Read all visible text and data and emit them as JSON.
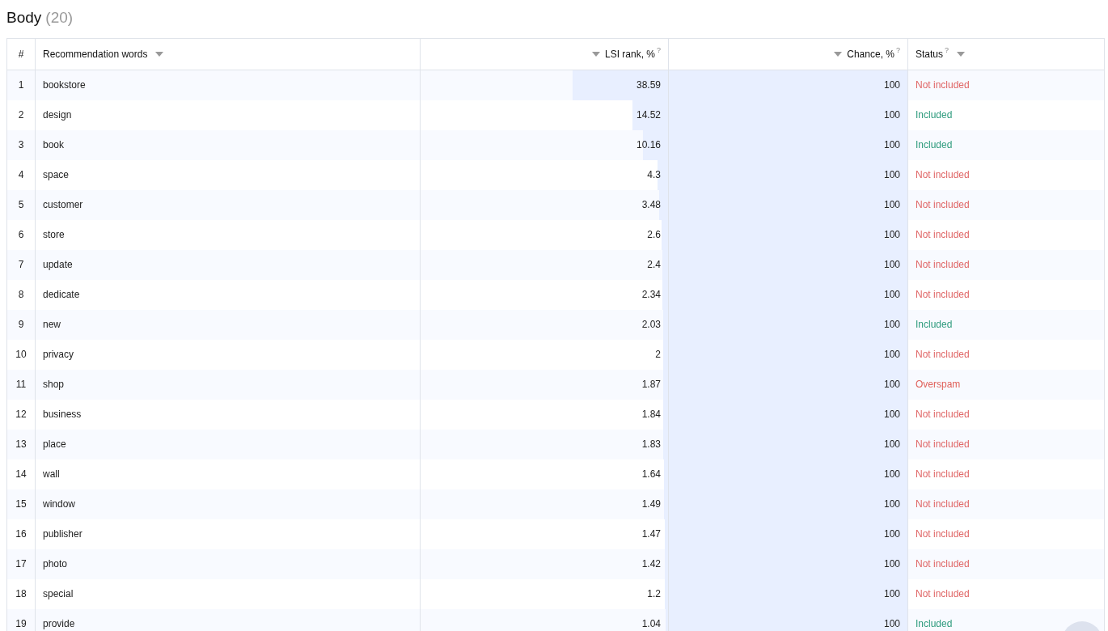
{
  "title": "Body",
  "count": "(20)",
  "columns": [
    {
      "label": "#",
      "kind": "index"
    },
    {
      "label": "Recommendation words",
      "kind": "text"
    },
    {
      "label": "LSI rank, %",
      "hint": "?",
      "kind": "number"
    },
    {
      "label": "Chance, %",
      "hint": "?",
      "kind": "number"
    },
    {
      "label": "Status",
      "hint": "?",
      "kind": "text"
    }
  ],
  "rows": [
    {
      "n": "1",
      "word": "bookstore",
      "rank": {
        "value": "38.59",
        "level": 0.3859
      },
      "chance": {
        "value": "100",
        "level": 1
      },
      "status": "Not included",
      "color": "#e06666"
    },
    {
      "n": "2",
      "word": "design",
      "rank": {
        "value": "14.52",
        "level": 0.1452
      },
      "chance": {
        "value": "100",
        "level": 1
      },
      "status": "Included",
      "color": "#2e9b7d"
    },
    {
      "n": "3",
      "word": "book",
      "rank": {
        "value": "10.16",
        "level": 0.1016
      },
      "chance": {
        "value": "100",
        "level": 1
      },
      "status": "Included",
      "color": "#2e9b7d"
    },
    {
      "n": "4",
      "word": "space",
      "rank": {
        "value": "4.3",
        "level": 0.043
      },
      "chance": {
        "value": "100",
        "level": 1
      },
      "status": "Not included",
      "color": "#e06666"
    },
    {
      "n": "5",
      "word": "customer",
      "rank": {
        "value": "3.48",
        "level": 0.0348
      },
      "chance": {
        "value": "100",
        "level": 1
      },
      "status": "Not included",
      "color": "#e06666"
    },
    {
      "n": "6",
      "word": "store",
      "rank": {
        "value": "2.6",
        "level": 0.026
      },
      "chance": {
        "value": "100",
        "level": 1
      },
      "status": "Not included",
      "color": "#e06666"
    },
    {
      "n": "7",
      "word": "update",
      "rank": {
        "value": "2.4",
        "level": 0.024
      },
      "chance": {
        "value": "100",
        "level": 1
      },
      "status": "Not included",
      "color": "#e06666"
    },
    {
      "n": "8",
      "word": "dedicate",
      "rank": {
        "value": "2.34",
        "level": 0.0234
      },
      "chance": {
        "value": "100",
        "level": 1
      },
      "status": "Not included",
      "color": "#e06666"
    },
    {
      "n": "9",
      "word": "new",
      "rank": {
        "value": "2.03",
        "level": 0.0203
      },
      "chance": {
        "value": "100",
        "level": 1
      },
      "status": "Included",
      "color": "#2e9b7d"
    },
    {
      "n": "10",
      "word": "privacy",
      "rank": {
        "value": "2",
        "level": 0.02
      },
      "chance": {
        "value": "100",
        "level": 1
      },
      "status": "Not included",
      "color": "#e06666"
    },
    {
      "n": "11",
      "word": "shop",
      "rank": {
        "value": "1.87",
        "level": 0.0187
      },
      "chance": {
        "value": "100",
        "level": 1
      },
      "status": "Overspam",
      "color": "#e0605a"
    },
    {
      "n": "12",
      "word": "business",
      "rank": {
        "value": "1.84",
        "level": 0.0184
      },
      "chance": {
        "value": "100",
        "level": 1
      },
      "status": "Not included",
      "color": "#e06666"
    },
    {
      "n": "13",
      "word": "place",
      "rank": {
        "value": "1.83",
        "level": 0.0183
      },
      "chance": {
        "value": "100",
        "level": 1
      },
      "status": "Not included",
      "color": "#e06666"
    },
    {
      "n": "14",
      "word": "wall",
      "rank": {
        "value": "1.64",
        "level": 0.0164
      },
      "chance": {
        "value": "100",
        "level": 1
      },
      "status": "Not included",
      "color": "#e06666"
    },
    {
      "n": "15",
      "word": "window",
      "rank": {
        "value": "1.49",
        "level": 0.0149
      },
      "chance": {
        "value": "100",
        "level": 1
      },
      "status": "Not included",
      "color": "#e06666"
    },
    {
      "n": "16",
      "word": "publisher",
      "rank": {
        "value": "1.47",
        "level": 0.0147
      },
      "chance": {
        "value": "100",
        "level": 1
      },
      "status": "Not included",
      "color": "#e06666"
    },
    {
      "n": "17",
      "word": "photo",
      "rank": {
        "value": "1.42",
        "level": 0.0142
      },
      "chance": {
        "value": "100",
        "level": 1
      },
      "status": "Not included",
      "color": "#e06666"
    },
    {
      "n": "18",
      "word": "special",
      "rank": {
        "value": "1.2",
        "level": 0.012
      },
      "chance": {
        "value": "100",
        "level": 1
      },
      "status": "Not included",
      "color": "#e06666"
    },
    {
      "n": "19",
      "word": "provide",
      "rank": {
        "value": "1.04",
        "level": 0.0104
      },
      "chance": {
        "value": "100",
        "level": 1
      },
      "status": "Included",
      "color": "#2e9b7d"
    }
  ]
}
